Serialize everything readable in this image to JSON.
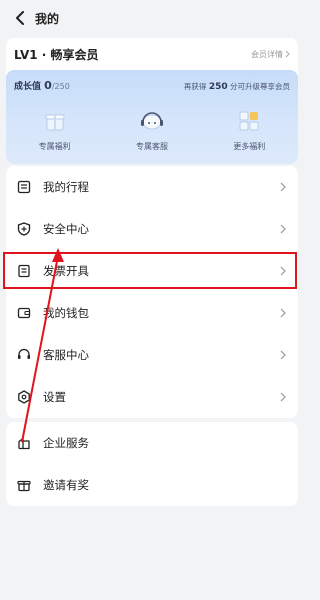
{
  "header": {
    "title": "我的"
  },
  "member": {
    "level": "LV1 · 畅享会员",
    "detail_link": "会员详情",
    "growth_label": "成长值",
    "growth_value": "0",
    "growth_total": "/250",
    "upgrade_prefix": "再获得",
    "upgrade_points": "250",
    "upgrade_suffix": "分可升级尊享会员",
    "perks": [
      {
        "label": "专属福利",
        "icon": "gift-box-icon"
      },
      {
        "label": "专属客服",
        "icon": "customer-service-icon"
      },
      {
        "label": "更多福利",
        "icon": "grid-more-icon"
      }
    ]
  },
  "menu_main": [
    {
      "label": "我的行程",
      "icon": "trip-list-icon"
    },
    {
      "label": "安全中心",
      "icon": "shield-icon"
    },
    {
      "label": "发票开具",
      "icon": "invoice-icon"
    },
    {
      "label": "我的钱包",
      "icon": "wallet-icon"
    },
    {
      "label": "客服中心",
      "icon": "headset-icon"
    },
    {
      "label": "设置",
      "icon": "settings-icon"
    }
  ],
  "menu_extra": [
    {
      "label": "企业服务",
      "icon": "building-icon"
    },
    {
      "label": "邀请有奖",
      "icon": "gift-icon"
    }
  ],
  "colors": {
    "highlight": "#e0141c",
    "card_gradient": "#c6dcf9"
  }
}
